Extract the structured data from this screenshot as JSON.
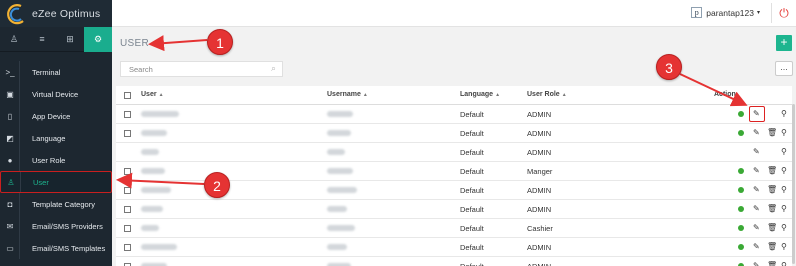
{
  "app": {
    "name": "eZee Optimus"
  },
  "header": {
    "user_initial": "p",
    "username": "parantap123",
    "caret": "▾",
    "power_icon": "power-icon"
  },
  "sidebar": {
    "tabs": [
      {
        "icon": "user-icon",
        "glyph": "♙"
      },
      {
        "icon": "list-icon",
        "glyph": "≡"
      },
      {
        "icon": "cart-icon",
        "glyph": "⊞"
      },
      {
        "icon": "settings-icon",
        "glyph": "⚙"
      }
    ],
    "items": [
      {
        "label": "Terminal",
        "glyph": ">_",
        "icon": "terminal-icon"
      },
      {
        "label": "Virtual Device",
        "glyph": "▣",
        "icon": "device-icon"
      },
      {
        "label": "App Device",
        "glyph": "▯",
        "icon": "mobile-icon"
      },
      {
        "label": "Language",
        "glyph": "◩",
        "icon": "language-icon"
      },
      {
        "label": "User Role",
        "glyph": "●",
        "icon": "user-role-icon"
      },
      {
        "label": "User",
        "glyph": "♙",
        "icon": "user-icon"
      },
      {
        "label": "Template Category",
        "glyph": "◘",
        "icon": "template-icon"
      },
      {
        "label": "Email/SMS Providers",
        "glyph": "✉",
        "icon": "mail-icon"
      },
      {
        "label": "Email/SMS Templates",
        "glyph": "▭",
        "icon": "mail-template-icon"
      }
    ]
  },
  "page": {
    "title": "USER",
    "add_label": "+",
    "more_label": "...",
    "search_placeholder": "Search"
  },
  "table": {
    "columns": [
      "User",
      "Username",
      "Language",
      "User Role",
      "Action"
    ],
    "sort_glyph": "▲",
    "rows": [
      {
        "language": "Default",
        "role": "ADMIN",
        "has_checkbox": true,
        "status": true,
        "delete": false
      },
      {
        "language": "Default",
        "role": "ADMIN",
        "has_checkbox": true,
        "status": true,
        "delete": true
      },
      {
        "language": "Default",
        "role": "ADMIN",
        "has_checkbox": false,
        "status": false,
        "delete": false
      },
      {
        "language": "Default",
        "role": "Manger",
        "has_checkbox": true,
        "status": true,
        "delete": true
      },
      {
        "language": "Default",
        "role": "ADMIN",
        "has_checkbox": true,
        "status": true,
        "delete": true
      },
      {
        "language": "Default",
        "role": "ADMIN",
        "has_checkbox": true,
        "status": true,
        "delete": true
      },
      {
        "language": "Default",
        "role": "Cashier",
        "has_checkbox": true,
        "status": true,
        "delete": true
      },
      {
        "language": "Default",
        "role": "ADMIN",
        "has_checkbox": true,
        "status": true,
        "delete": true
      },
      {
        "language": "Default",
        "role": "ADMIN",
        "has_checkbox": true,
        "status": true,
        "delete": true
      }
    ]
  },
  "callouts": [
    "1",
    "2",
    "3"
  ],
  "colors": {
    "accent": "#1db58f",
    "sidebar": "#1d2730",
    "callout": "#e53333",
    "status": "#3aa935"
  }
}
